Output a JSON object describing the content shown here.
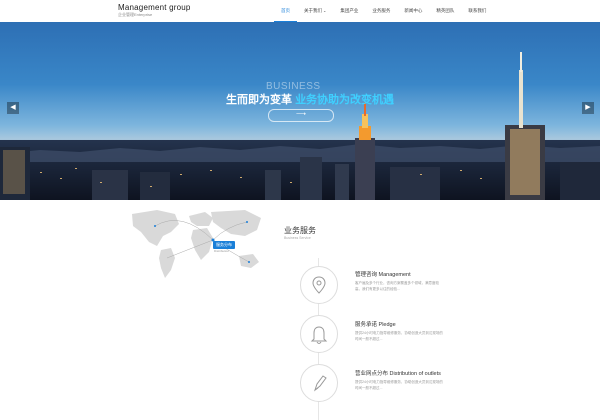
{
  "header": {
    "logo_title": "Management group",
    "logo_sub": "企业管理Enterprise",
    "nav": [
      {
        "label": "首页",
        "active": true
      },
      {
        "label": "关于我们",
        "dropdown": true
      },
      {
        "label": "集团产业"
      },
      {
        "label": "业务服务"
      },
      {
        "label": "新闻中心"
      },
      {
        "label": "精英团队"
      },
      {
        "label": "联系我们"
      }
    ]
  },
  "banner": {
    "eng_title": "BUSINESS",
    "headline_white": "生而即为变革",
    "headline_accent": "业务协助为改变机遇",
    "button_symbol": "⟶",
    "prev_icon": "◀",
    "next_icon": "▶"
  },
  "map": {
    "label": "服务分布",
    "sub": "Distribution"
  },
  "services": {
    "title": "业务服务",
    "subtitle": "Business Service",
    "items": [
      {
        "icon": "location-pin-icon",
        "title": "管理咨询 Management",
        "desc": "客户遍及多个行业，咨询方案覆盖多个领域，满意度较高，我们有更多以往的经验..."
      },
      {
        "icon": "bell-icon",
        "title": "服务承诺 Pledge",
        "desc": "提供24小时电力指导维修服务，协助创造大员到达现场的时间一般不超过..."
      },
      {
        "icon": "pen-icon",
        "title": "营业网点分布 Distribution of outlets",
        "desc": "提供24小时电力指导维修服务，协助创造大员到达现场的时间一般不超过..."
      }
    ]
  }
}
